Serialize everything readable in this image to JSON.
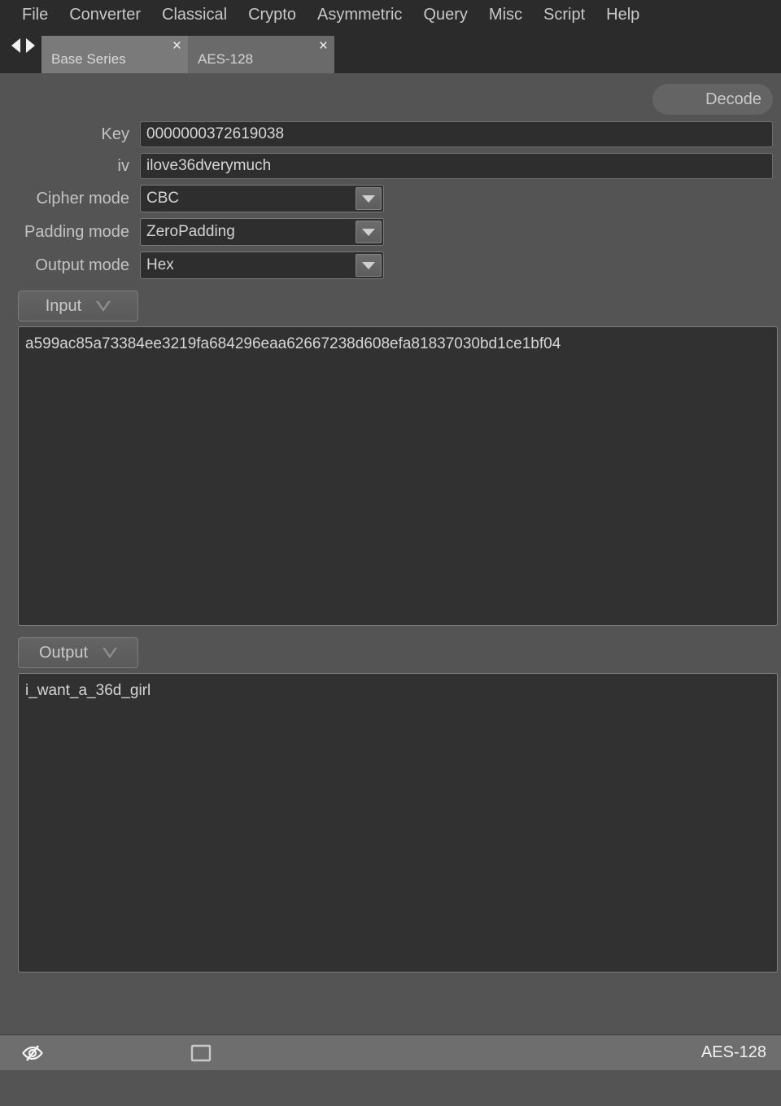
{
  "menubar": {
    "items": [
      {
        "label": "File"
      },
      {
        "label": "Converter"
      },
      {
        "label": "Classical"
      },
      {
        "label": "Crypto"
      },
      {
        "label": "Asymmetric"
      },
      {
        "label": "Query"
      },
      {
        "label": "Misc"
      },
      {
        "label": "Script"
      },
      {
        "label": "Help"
      }
    ]
  },
  "tabbar": {
    "nav_prev_icon": "triangle-left-icon",
    "nav_next_icon": "triangle-right-icon",
    "tabs": [
      {
        "label": "Base Series",
        "close_label": "×",
        "active": false
      },
      {
        "label": "AES-128",
        "close_label": "×",
        "active": true
      }
    ]
  },
  "toolbar": {
    "decode_label": "Decode"
  },
  "form": {
    "key": {
      "label": "Key",
      "value": "0000000372619038"
    },
    "iv": {
      "label": "iv",
      "value": "ilove36dverymuch"
    },
    "cipher_mode": {
      "label": "Cipher mode",
      "value": "CBC"
    },
    "padding_mode": {
      "label": "Padding mode",
      "value": "ZeroPadding"
    },
    "output_mode": {
      "label": "Output mode",
      "value": "Hex"
    }
  },
  "input_section": {
    "button_label": "Input",
    "dropdown_icon": "triangle-down-outline-icon",
    "text": "a599ac85a73384ee3219fa684296eaa62667238d608efa81837030bd1ce1bf04"
  },
  "output_section": {
    "button_label": "Output",
    "dropdown_icon": "triangle-down-outline-icon",
    "text": "i_want_a_36d_girl"
  },
  "statusbar": {
    "eye_off_icon": "eye-off-icon",
    "window_icon": "window-rectangle-icon",
    "mode_label": "AES-128"
  },
  "colors": {
    "window_bg": "#545454",
    "menubar_bg": "#2b2b2b",
    "field_bg": "#2e2e2e",
    "textarea_bg": "#313131",
    "statusbar_bg": "#6e6e6e",
    "text": "#c9c9c9",
    "tab_active": "#6a6a6a",
    "tab_inactive": "#7a7a7a"
  }
}
